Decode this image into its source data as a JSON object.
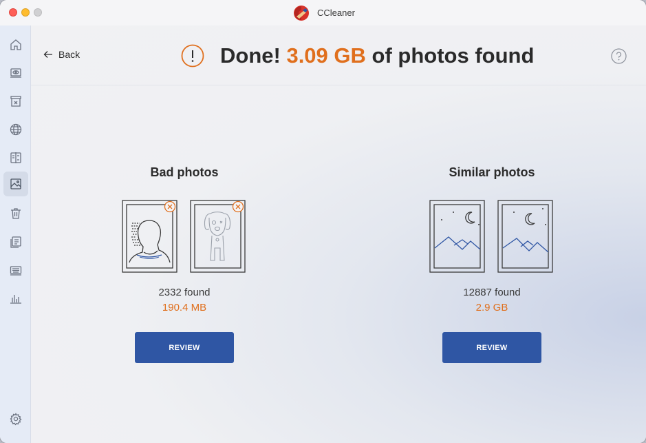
{
  "window": {
    "app_title": "CCleaner",
    "app_icon": "ccleaner-logo"
  },
  "sidebar": {
    "items": [
      {
        "icon": "home-icon"
      },
      {
        "icon": "eye-scan-icon"
      },
      {
        "icon": "archive-box-icon"
      },
      {
        "icon": "globe-icon"
      },
      {
        "icon": "compare-files-icon"
      },
      {
        "icon": "image-icon",
        "active": true
      },
      {
        "icon": "trash-icon"
      },
      {
        "icon": "file-settings-icon"
      },
      {
        "icon": "keyboard-icon"
      },
      {
        "icon": "bar-chart-icon"
      },
      {
        "icon": "gear-icon"
      }
    ]
  },
  "header": {
    "back_label": "Back",
    "headline_prefix": "Done!",
    "headline_accent": "3.09 GB",
    "headline_suffix": "of photos found"
  },
  "cards": {
    "bad": {
      "title": "Bad photos",
      "count": "2332 found",
      "size": "190.4 MB",
      "button": "REVIEW"
    },
    "similar": {
      "title": "Similar photos",
      "count": "12887 found",
      "size": "2.9 GB",
      "button": "REVIEW"
    }
  },
  "colors": {
    "accent_orange": "#e06f1d",
    "button_blue": "#2f56a4",
    "sidebar_bg": "#e5ebf6"
  }
}
